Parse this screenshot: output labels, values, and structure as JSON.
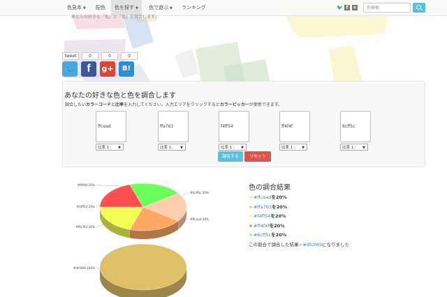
{
  "nav": {
    "items": [
      {
        "label": "色見本",
        "caret": true,
        "active": false
      },
      {
        "label": "配色",
        "caret": false,
        "active": false
      },
      {
        "label": "色を探す",
        "caret": true,
        "active": true
      },
      {
        "label": "色で遊ぶ",
        "caret": true,
        "active": false
      },
      {
        "label": "ランキング",
        "caret": false,
        "active": false
      }
    ],
    "social_icons": [
      "twitter-icon",
      "facebook-icon",
      "rss-icon"
    ],
    "search_placeholder": "色検索",
    "search_button_icon": "search-icon"
  },
  "subtitle": "あなたの好きな「色」と「色」を調合します。",
  "share": {
    "tweet_label": "tweet",
    "counts": [
      "0",
      "0",
      "0"
    ],
    "buttons": [
      {
        "icon": "twitter-icon",
        "glyph": "🐦",
        "color": "#4aa6dc"
      },
      {
        "icon": "facebook-icon",
        "glyph": "f",
        "color": "#3b5998"
      },
      {
        "icon": "googleplus-icon",
        "glyph": "g+",
        "color": "#d34836"
      },
      {
        "icon": "hatena-icon",
        "glyph": "B!",
        "color": "#2c8dd8"
      }
    ]
  },
  "panel": {
    "title": "あなたの好きな色と色を調合します",
    "desc_pre": "調合したい",
    "desc_b1": "カラーコード",
    "desc_mid1": "と",
    "desc_b2": "比率",
    "desc_mid2": "を入力してください。入力エリアをクリックすると",
    "desc_b3": "カラーピッカー",
    "desc_post": "が使用できます。",
    "colors": [
      {
        "value": "ffcead",
        "ratio": "比率 1 :"
      },
      {
        "value": "ffa763",
        "ratio": "比率 1 :"
      },
      {
        "value": "f4ff54",
        "ratio": "比率 1 :"
      },
      {
        "value": "ff4f4f",
        "ratio": "比率 1 :"
      },
      {
        "value": "6cff5c",
        "ratio": "比率 1 :"
      }
    ],
    "mix_button": "調合する",
    "reset_button": "リセット",
    "mix_color": "#5bc0de",
    "reset_color": "#d9534f"
  },
  "chart_data": [
    {
      "type": "pie",
      "title": "",
      "labels": [
        "#ffcead 20%",
        "#ffa763 20%",
        "#f4ff54 20%",
        "#ff4f4f 20%",
        "#6cff5c 20%"
      ],
      "values": [
        20,
        20,
        20,
        20,
        20
      ],
      "colors": [
        "#ffcead",
        "#ffa763",
        "#f4ff54",
        "#ff4f4f",
        "#6cff5c"
      ],
      "style": "3d"
    },
    {
      "type": "pie",
      "title": "",
      "labels": [
        "#dfc069 100%"
      ],
      "values": [
        100
      ],
      "colors": [
        "#dfc069"
      ],
      "style": "3d"
    }
  ],
  "results": {
    "title": "色の調合結果",
    "lines": [
      {
        "star_color": "#ffcead",
        "code": "#ffcead",
        "suffix": "を20%"
      },
      {
        "star_color": "#ffa763",
        "code": "#ffa763",
        "suffix": "を20%"
      },
      {
        "star_color": "#f4ff54",
        "code": "#f4ff54",
        "suffix": "を20%"
      },
      {
        "star_color": "#ff4f4f",
        "code": "#ff4f4f",
        "suffix": "を20%"
      },
      {
        "star_color": "#6cff5c",
        "code": "#6cff5c",
        "suffix": "を20%"
      }
    ],
    "summary_pre": "この割合で調合した結果",
    "summary_code": "#dfc069",
    "summary_star_color": "#dfc069",
    "summary_post": "になりました"
  }
}
